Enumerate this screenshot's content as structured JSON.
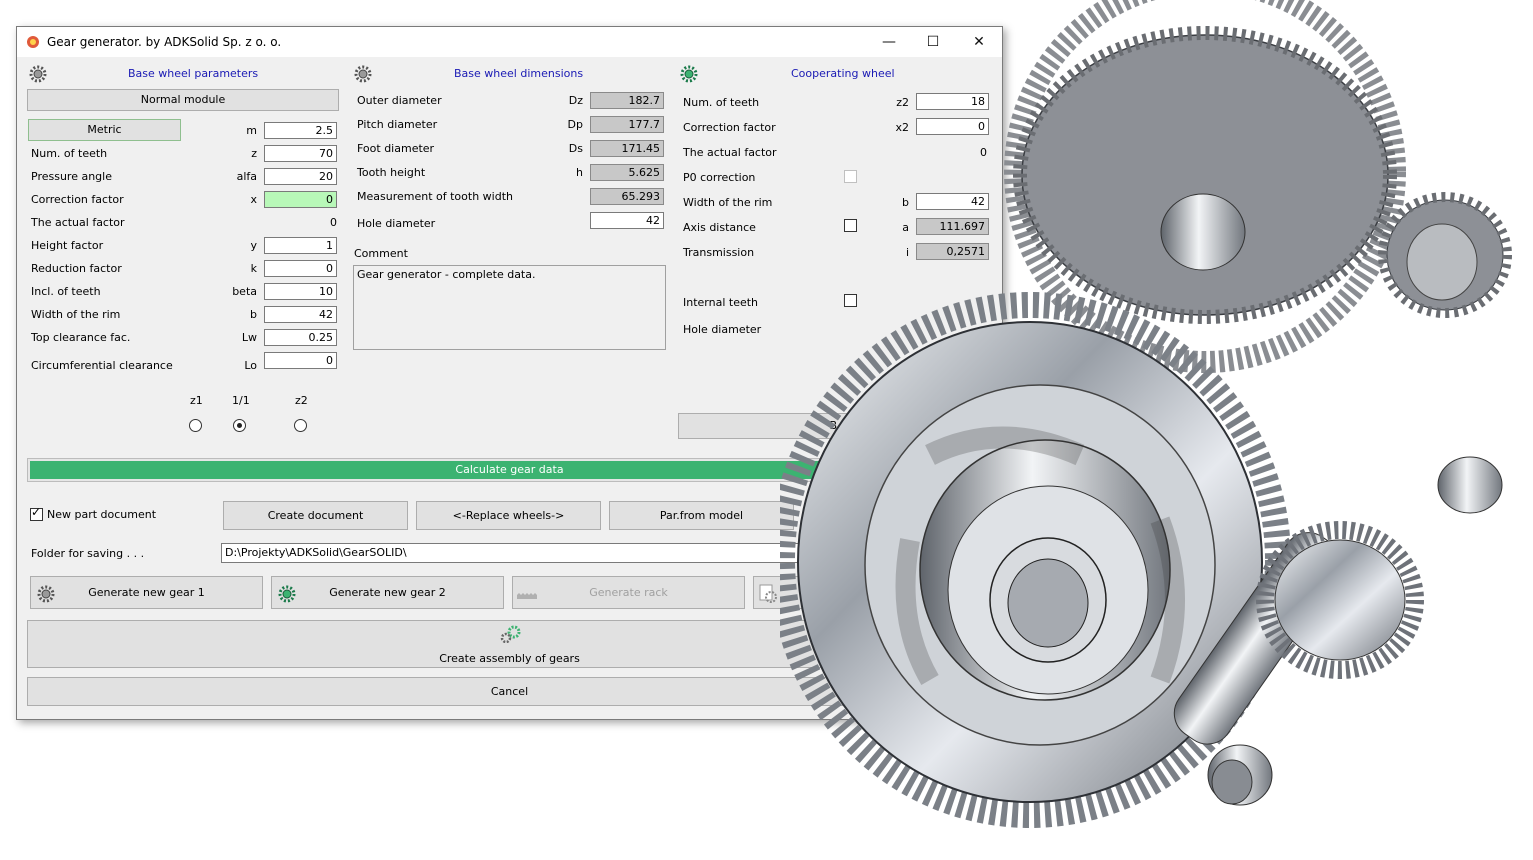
{
  "window": {
    "title": "Gear generator. by  ADKSolid Sp. z o. o.",
    "controls": {
      "minimize": "—",
      "maximize": "☐",
      "close": "✕"
    }
  },
  "base_params": {
    "heading": "Base wheel parameters",
    "normal_module_button": "Normal module",
    "metric_button": "Metric",
    "rows": [
      {
        "label": "",
        "symbol": "m",
        "value": "2.5"
      },
      {
        "label": "Num. of teeth",
        "symbol": "z",
        "value": "70"
      },
      {
        "label": "Pressure angle",
        "symbol": "alfa",
        "value": "20"
      },
      {
        "label": "Correction factor",
        "symbol": "x",
        "value": "0"
      },
      {
        "label": "The actual factor",
        "symbol": "",
        "value": "0"
      },
      {
        "label": "Height factor",
        "symbol": "y",
        "value": "1"
      },
      {
        "label": "Reduction factor",
        "symbol": "k",
        "value": "0"
      },
      {
        "label": "Incl. of teeth",
        "symbol": "beta",
        "value": "10"
      },
      {
        "label": "Width of the rim",
        "symbol": "b",
        "value": "42"
      },
      {
        "label": "Top clearance fac.",
        "symbol": "Lw",
        "value": "0.25"
      },
      {
        "label": "Circumferential clearance",
        "symbol": "Lo",
        "value": "0"
      }
    ],
    "radios": [
      {
        "label": "z1",
        "selected": false
      },
      {
        "label": "1/1",
        "selected": true
      },
      {
        "label": "z2",
        "selected": false
      }
    ]
  },
  "base_dims": {
    "heading": "Base wheel dimensions",
    "rows": [
      {
        "label": "Outer diameter",
        "symbol": "Dz",
        "value": "182.7"
      },
      {
        "label": "Pitch diameter",
        "symbol": "Dp",
        "value": "177.7"
      },
      {
        "label": "Foot diameter",
        "symbol": "Ds",
        "value": "171.45"
      },
      {
        "label": "Tooth height",
        "symbol": "h",
        "value": "5.625"
      },
      {
        "label": "Measurement of tooth width",
        "symbol": "",
        "value": "65.293"
      },
      {
        "label": "Hole diameter",
        "symbol": "",
        "value": "42"
      }
    ],
    "comment_label": "Comment",
    "comment_text": "Gear generator - complete data."
  },
  "coop": {
    "heading": "Cooperating wheel",
    "rows": [
      {
        "label": "Num. of teeth",
        "symbol": "z2",
        "value": "18"
      },
      {
        "label": "Correction factor",
        "symbol": "x2",
        "value": "0"
      },
      {
        "label": "The actual factor",
        "symbol": "",
        "value": "0"
      },
      {
        "label": "P0 correction",
        "symbol": "",
        "value": ""
      },
      {
        "label": "Width of the rim",
        "symbol": "b",
        "value": "42"
      },
      {
        "label": "Axis distance",
        "symbol": "a",
        "value": "111.697"
      },
      {
        "label": "Transmission",
        "symbol": "i",
        "value": "0,2571"
      }
    ],
    "internal_teeth_label": "Internal teeth",
    "hole_diameter_label": "Hole diameter",
    "partial_button": "B"
  },
  "actions": {
    "calculate": "Calculate gear data",
    "new_part_doc": "New part document",
    "create_document": "Create document",
    "replace_wheels": "<-Replace wheels->",
    "par_from_model": "Par.from model",
    "folder_label": "Folder for saving . . .",
    "folder_path": "D:\\Projekty\\ADKSolid\\GearSOLID\\",
    "gen_gear1": "Generate new gear 1",
    "gen_gear2": "Generate new gear 2",
    "gen_rack": "Generate rack",
    "create_assembly": "Create assembly of gears",
    "cancel": "Cancel"
  },
  "colors": {
    "progress_green": "#3cb371",
    "accent_green_field": "#b8f8b8",
    "heading_blue": "#1a1ab4"
  }
}
